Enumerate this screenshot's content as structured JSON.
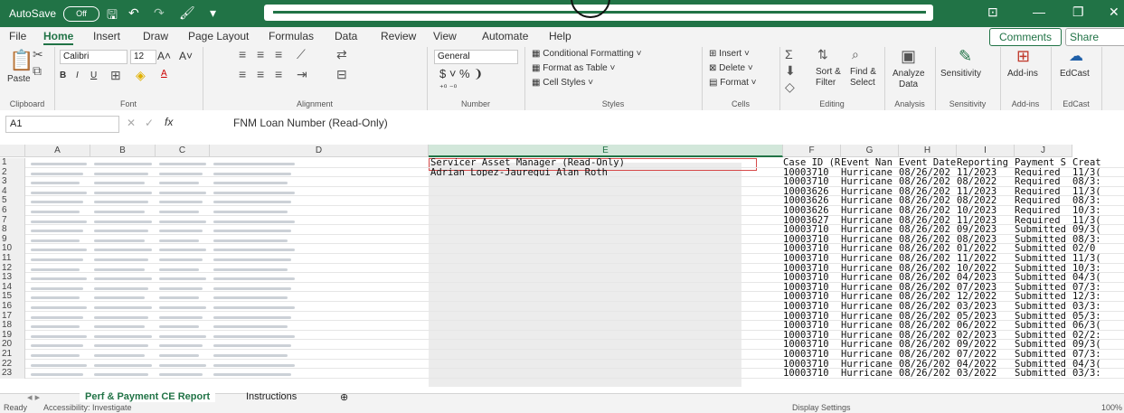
{
  "titlebar": {
    "autosave": "AutoSave",
    "toggle": "Off",
    "accent": "#217346"
  },
  "ribbon_tabs": [
    "File",
    "Home",
    "Insert",
    "Draw",
    "Page Layout",
    "Formulas",
    "Data",
    "Review",
    "View",
    "Automate",
    "Help"
  ],
  "ribbon_actions": {
    "comments": "Comments",
    "share": "Share"
  },
  "clipboard": {
    "paste": "Paste",
    "label": "Clipboard"
  },
  "font": {
    "name": "Calibri",
    "size": "12",
    "label": "Font"
  },
  "alignment": {
    "label": "Alignment"
  },
  "number": {
    "format": "General",
    "label": "Number"
  },
  "styles": {
    "items": [
      "Conditional Formatting",
      "Format as Table",
      "Cell Styles"
    ],
    "label": "Styles"
  },
  "cells": {
    "items": [
      "Insert",
      "Delete",
      "Format"
    ],
    "label": "Cells"
  },
  "editing": {
    "sort": "Sort &",
    "sort2": "Filter",
    "find": "Find &",
    "find2": "Select",
    "label": "Editing"
  },
  "analysis": {
    "btn": "Analyze",
    "btn2": "Data",
    "label": "Analysis"
  },
  "sensitivity": {
    "btn": "Sensitivity",
    "label": "Sensitivity"
  },
  "addins": {
    "btn": "Add-ins",
    "label": "Add-ins"
  },
  "edcast": {
    "btn": "EdCast",
    "label": "EdCast"
  },
  "formula_bar": {
    "namebox": "A1",
    "fx": "fx",
    "content": "FNM Loan Number (Read-Only)"
  },
  "columns": [
    "A",
    "B",
    "C",
    "D",
    "E",
    "F",
    "G",
    "H",
    "I",
    "J"
  ],
  "header_row": {
    "E": "Servicer Asset Manager (Read-Only)",
    "F": "Case ID (Re",
    "G": "Event Nan",
    "H": "Event Date",
    "I": "Reporting",
    "J": "Payment S",
    "K": "Creat"
  },
  "row2_E": "Adrian Lopez-Jauregui Alan Roth",
  "rows": [
    {
      "n": "2",
      "F": "10003710",
      "G": "Hurricane",
      "H": "08/26/202",
      "I": "11/2023",
      "J": "Required",
      "K": "11/3("
    },
    {
      "n": "3",
      "F": "10003710",
      "G": "Hurricane",
      "H": "08/26/202",
      "I": "08/2022",
      "J": "Required",
      "K": "08/3:"
    },
    {
      "n": "4",
      "F": "10003626",
      "G": "Hurricane",
      "H": "08/26/202",
      "I": "11/2023",
      "J": "Required",
      "K": "11/3("
    },
    {
      "n": "5",
      "F": "10003626",
      "G": "Hurricane",
      "H": "08/26/202",
      "I": "08/2022",
      "J": "Required",
      "K": "08/3:"
    },
    {
      "n": "6",
      "F": "10003626",
      "G": "Hurricane",
      "H": "08/26/202",
      "I": "10/2023",
      "J": "Required",
      "K": "10/3:"
    },
    {
      "n": "7",
      "F": "10003627",
      "G": "Hurricane",
      "H": "08/26/202",
      "I": "11/2023",
      "J": "Required",
      "K": "11/3("
    },
    {
      "n": "8",
      "F": "10003710",
      "G": "Hurricane",
      "H": "08/26/202",
      "I": "09/2023",
      "J": "Submitted",
      "K": "09/3("
    },
    {
      "n": "9",
      "F": "10003710",
      "G": "Hurricane",
      "H": "08/26/202",
      "I": "08/2023",
      "J": "Submitted",
      "K": "08/3:"
    },
    {
      "n": "10",
      "F": "10003710",
      "G": "Hurricane",
      "H": "08/26/202",
      "I": "01/2022",
      "J": "Submitted",
      "K": "02/0"
    },
    {
      "n": "11",
      "F": "10003710",
      "G": "Hurricane",
      "H": "08/26/202",
      "I": "11/2022",
      "J": "Submitted",
      "K": "11/3("
    },
    {
      "n": "12",
      "F": "10003710",
      "G": "Hurricane",
      "H": "08/26/202",
      "I": "10/2022",
      "J": "Submitted",
      "K": "10/3:"
    },
    {
      "n": "13",
      "F": "10003710",
      "G": "Hurricane",
      "H": "08/26/202",
      "I": "04/2023",
      "J": "Submitted",
      "K": "04/3("
    },
    {
      "n": "14",
      "F": "10003710",
      "G": "Hurricane",
      "H": "08/26/202",
      "I": "07/2023",
      "J": "Submitted",
      "K": "07/3:"
    },
    {
      "n": "15",
      "F": "10003710",
      "G": "Hurricane",
      "H": "08/26/202",
      "I": "12/2022",
      "J": "Submitted",
      "K": "12/3:"
    },
    {
      "n": "16",
      "F": "10003710",
      "G": "Hurricane",
      "H": "08/26/202",
      "I": "03/2023",
      "J": "Submitted",
      "K": "03/3:"
    },
    {
      "n": "17",
      "F": "10003710",
      "G": "Hurricane",
      "H": "08/26/202",
      "I": "05/2023",
      "J": "Submitted",
      "K": "05/3:"
    },
    {
      "n": "18",
      "F": "10003710",
      "G": "Hurricane",
      "H": "08/26/202",
      "I": "06/2022",
      "J": "Submitted",
      "K": "06/3("
    },
    {
      "n": "19",
      "F": "10003710",
      "G": "Hurricane",
      "H": "08/26/202",
      "I": "02/2023",
      "J": "Submitted",
      "K": "02/2:"
    },
    {
      "n": "20",
      "F": "10003710",
      "G": "Hurricane",
      "H": "08/26/202",
      "I": "09/2022",
      "J": "Submitted",
      "K": "09/3("
    },
    {
      "n": "21",
      "F": "10003710",
      "G": "Hurricane",
      "H": "08/26/202",
      "I": "07/2022",
      "J": "Submitted",
      "K": "07/3:"
    },
    {
      "n": "22",
      "F": "10003710",
      "G": "Hurricane",
      "H": "08/26/202",
      "I": "04/2022",
      "J": "Submitted",
      "K": "04/3("
    },
    {
      "n": "23",
      "F": "10003710",
      "G": "Hurricane",
      "H": "08/26/202",
      "I": "03/2022",
      "J": "Submitted",
      "K": "03/3:"
    }
  ],
  "sheets": {
    "active": "Perf & Payment CE Report",
    "other": "Instructions"
  },
  "status": {
    "ready": "Ready",
    "accessibility": "Accessibility: Investigate",
    "display": "Display Settings",
    "zoom": "100%"
  }
}
